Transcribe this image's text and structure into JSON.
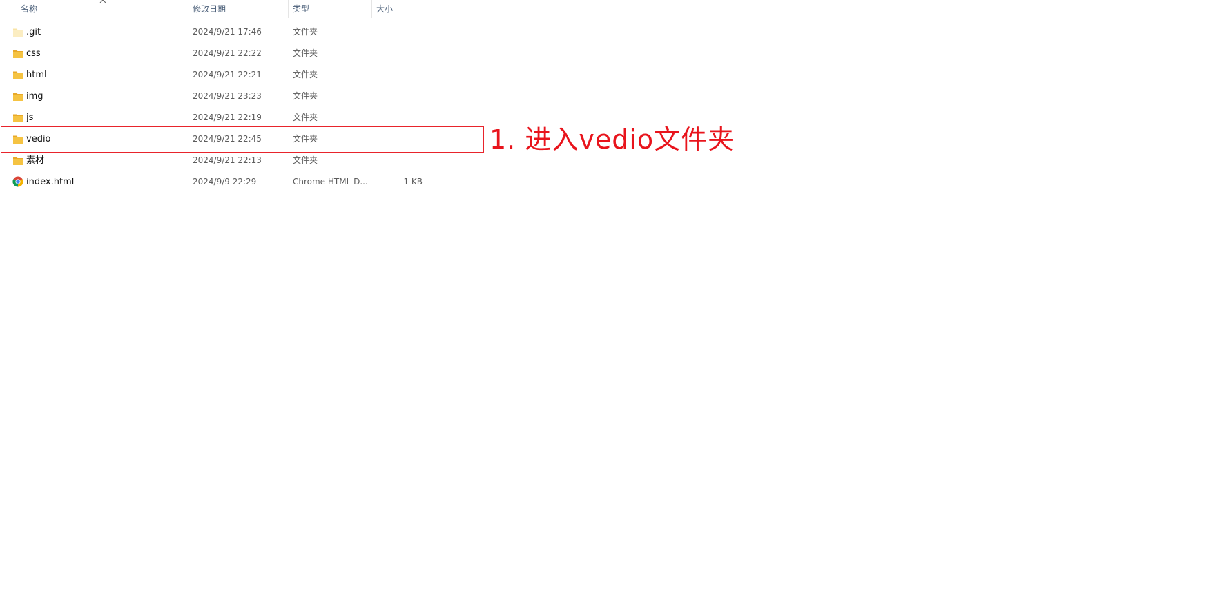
{
  "columns": {
    "name": "名称",
    "modified": "修改日期",
    "type": "类型",
    "size": "大小"
  },
  "rows": [
    {
      "name": ".git",
      "modified": "2024/9/21 17:46",
      "type": "文件夹",
      "size": "",
      "icon": "folder-light-icon"
    },
    {
      "name": "css",
      "modified": "2024/9/21 22:22",
      "type": "文件夹",
      "size": "",
      "icon": "folder-icon"
    },
    {
      "name": "html",
      "modified": "2024/9/21 22:21",
      "type": "文件夹",
      "size": "",
      "icon": "folder-icon"
    },
    {
      "name": "img",
      "modified": "2024/9/21 23:23",
      "type": "文件夹",
      "size": "",
      "icon": "folder-icon"
    },
    {
      "name": "js",
      "modified": "2024/9/21 22:19",
      "type": "文件夹",
      "size": "",
      "icon": "folder-icon"
    },
    {
      "name": "vedio",
      "modified": "2024/9/21 22:45",
      "type": "文件夹",
      "size": "",
      "icon": "folder-icon"
    },
    {
      "name": "素材",
      "modified": "2024/9/21 22:13",
      "type": "文件夹",
      "size": "",
      "icon": "folder-icon"
    },
    {
      "name": "index.html",
      "modified": "2024/9/9 22:29",
      "type": "Chrome HTML D...",
      "size": "1 KB",
      "icon": "chrome-icon"
    }
  ],
  "annotation": {
    "text": "1. 进入vedio文件夹",
    "color": "#e8141c"
  },
  "colors": {
    "folder": "#f5c342",
    "folder_dark": "#e8a92a",
    "folder_light": "#f9e4a6",
    "header_text": "#4c607a"
  }
}
